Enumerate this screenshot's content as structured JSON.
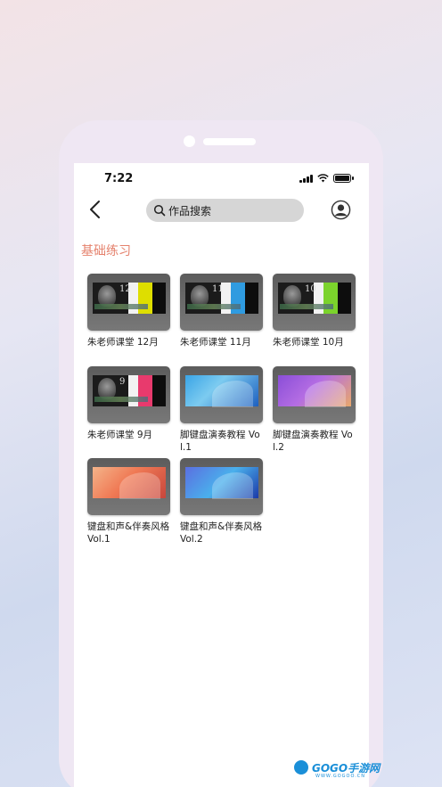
{
  "status_bar": {
    "time": "7:22"
  },
  "search": {
    "placeholder": "作品搜索"
  },
  "section": {
    "title": "基础练习"
  },
  "items": [
    {
      "label": "朱老师课堂 12月",
      "month": "12",
      "accent": "#dede00",
      "style": "teacher"
    },
    {
      "label": "朱老师课堂 11月",
      "month": "11",
      "accent": "#2f9be0",
      "style": "teacher"
    },
    {
      "label": "朱老师课堂 10月",
      "month": "10",
      "accent": "#7bd32c",
      "style": "teacher"
    },
    {
      "label": "朱老师课堂 9月",
      "month": "9",
      "accent": "#e83a6d",
      "style": "teacher"
    },
    {
      "label": "脚键盘演奏教程 Vol.1",
      "accent": "#3aa4e6",
      "style": "blue-wave"
    },
    {
      "label": "脚键盘演奏教程 Vol.2",
      "accent": "#8a4ed8",
      "style": "purple-wave"
    },
    {
      "label": "键盘和声&伴奏风格 Vol.1",
      "accent": "#f07a55",
      "style": "orange-wave"
    },
    {
      "label": "键盘和声&伴奏风格 Vol.2",
      "accent": "#5b6fe0",
      "style": "indigo-wave"
    }
  ],
  "watermark": {
    "text": "GOGO手游网",
    "sub": "WWW.GOGOO.CN"
  },
  "colors": {
    "section_title": "#e5826d",
    "search_bg": "#d6d6d6",
    "phone_frame": "#efe7f3"
  }
}
